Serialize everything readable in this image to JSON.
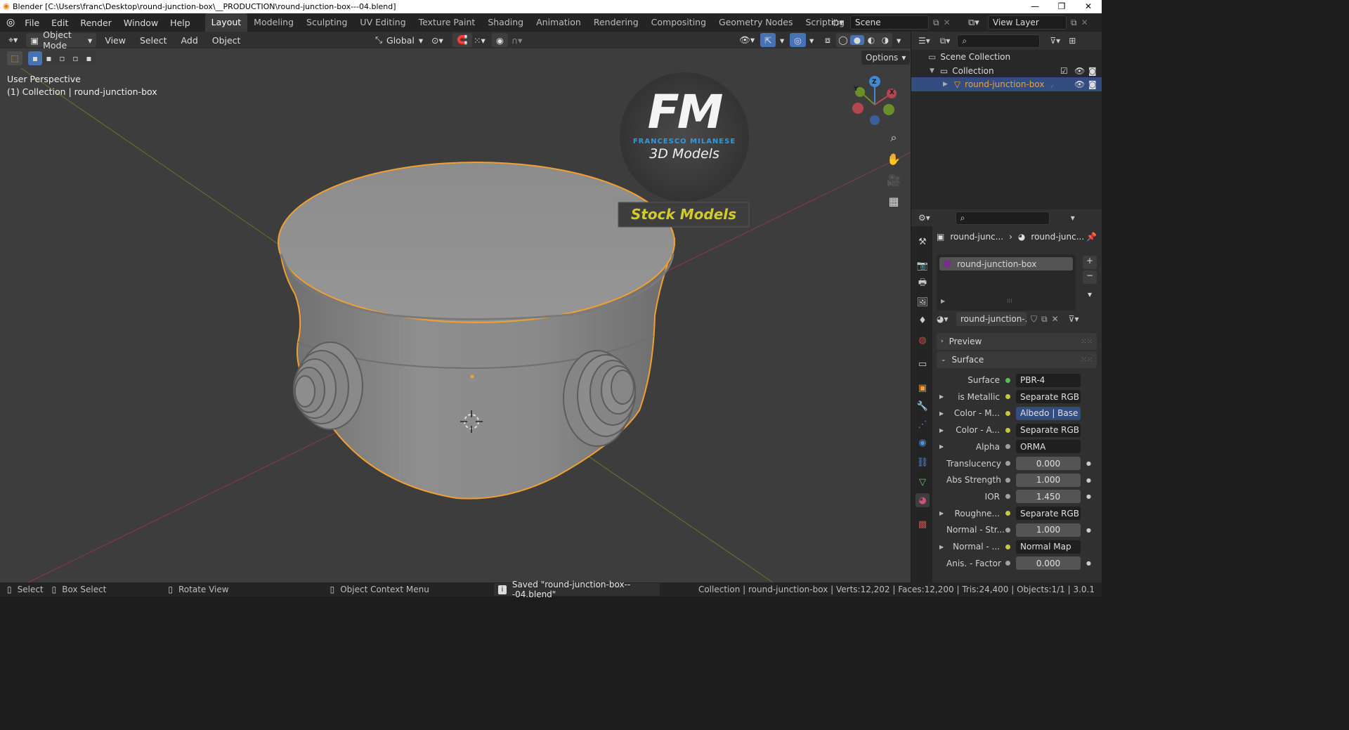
{
  "window": {
    "title": "Blender [C:\\Users\\franc\\Desktop\\round-junction-box\\__PRODUCTION\\round-junction-box---04.blend]",
    "minimize": "—",
    "maximize": "❐",
    "close": "✕"
  },
  "menu": [
    "File",
    "Edit",
    "Render",
    "Window",
    "Help"
  ],
  "workspaces": [
    {
      "label": "Layout",
      "active": true
    },
    {
      "label": "Modeling"
    },
    {
      "label": "Sculpting"
    },
    {
      "label": "UV Editing"
    },
    {
      "label": "Texture Paint"
    },
    {
      "label": "Shading"
    },
    {
      "label": "Animation"
    },
    {
      "label": "Rendering"
    },
    {
      "label": "Compositing"
    },
    {
      "label": "Geometry Nodes"
    },
    {
      "label": "Scripting"
    }
  ],
  "add_workspace": "+",
  "scene": {
    "label": "Scene"
  },
  "view_layer": {
    "label": "View Layer"
  },
  "viewport_header": {
    "mode": "Object Mode",
    "menus": [
      "View",
      "Select",
      "Add",
      "Object"
    ],
    "transform_orientation": "Global",
    "options": "Options"
  },
  "viewport": {
    "perspective": "User Perspective",
    "collection_info": "(1) Collection | round-junction-box",
    "gizmo_axes": {
      "x": "X",
      "y": "Y",
      "z": "Z"
    },
    "watermark": {
      "logo": "FM",
      "name": "FRANCESCO MILANESE",
      "subtitle": "3D Models",
      "banner": "Stock Models"
    }
  },
  "outliner": {
    "scene_collection": "Scene Collection",
    "collection": "Collection",
    "object": "round-junction-box"
  },
  "properties": {
    "breadcrumb_object": "round-junc...",
    "breadcrumb_material": "round-junc...",
    "material_slot": "round-junction-box",
    "material_name": "round-junction-...",
    "panels": {
      "preview": "Preview",
      "surface": "Surface"
    },
    "rows": [
      {
        "label": "Surface",
        "value": "PBR-4",
        "dot": "#54c054",
        "expand": false
      },
      {
        "label": "is Metallic",
        "value": "Separate RGB",
        "dot": "#c8c83c",
        "expand": true
      },
      {
        "label": "Color - M...",
        "value": "Albedo | Base C...",
        "dot": "#c8c83c",
        "expand": true,
        "highlight": true
      },
      {
        "label": "Color - A...",
        "value": "Separate RGB",
        "dot": "#c8c83c",
        "expand": true
      },
      {
        "label": "Alpha",
        "value": "ORMA",
        "dot": "#a0a0a0",
        "expand": true
      },
      {
        "label": "Translucency",
        "value": "0.000",
        "dot": "#a0a0a0",
        "expand": false,
        "num": true
      },
      {
        "label": "Abs Strength",
        "value": "1.000",
        "dot": "#a0a0a0",
        "expand": false,
        "num": true
      },
      {
        "label": "IOR",
        "value": "1.450",
        "dot": "#a0a0a0",
        "expand": false,
        "num": true
      },
      {
        "label": "Roughne...",
        "value": "Separate RGB",
        "dot": "#c8c83c",
        "expand": true
      },
      {
        "label": "Normal - Str...",
        "value": "1.000",
        "dot": "#a0a0a0",
        "expand": false,
        "num": true
      },
      {
        "label": "Normal - ...",
        "value": "Normal Map",
        "dot": "#c8c83c",
        "expand": true
      },
      {
        "label": "Anis. - Factor",
        "value": "0.000",
        "dot": "#a0a0a0",
        "expand": false,
        "num": true
      }
    ]
  },
  "statusbar": {
    "select": "Select",
    "box_select": "Box Select",
    "rotate_view": "Rotate View",
    "context_menu": "Object Context Menu",
    "saved_message": "Saved \"round-junction-box---04.blend\"",
    "stats": "Collection | round-junction-box | Verts:12,202 | Faces:12,200 | Tris:24,400 | Objects:1/1 | 3.0.1"
  },
  "colors": {
    "selection_outline": "#f0a030",
    "active_workspace": "#3b3b3b",
    "active_object_text": "#f0a030",
    "x_axis": "#b64552",
    "y_axis": "#6a8f2a",
    "z_axis": "#3f8ad6"
  }
}
